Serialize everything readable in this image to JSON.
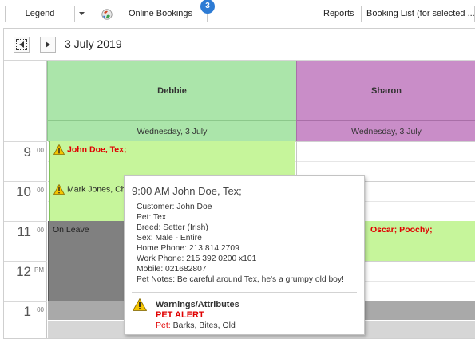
{
  "toolbar": {
    "legend_label": "Legend",
    "bookings_label": "Online Bookings",
    "bookings_badge": "3",
    "reports_label": "Reports",
    "reports_value": "Booking List (for selected ..."
  },
  "datenav": {
    "date": "3 July 2019"
  },
  "resources": [
    {
      "name": "Debbie",
      "day": "Wednesday, 3 July",
      "color": "#abe5aa"
    },
    {
      "name": "Sharon",
      "day": "Wednesday, 3 July",
      "color": "#c98dc8"
    }
  ],
  "hours": [
    {
      "h": "9",
      "m": "00"
    },
    {
      "h": "10",
      "m": "00"
    },
    {
      "h": "11",
      "m": "00"
    },
    {
      "h": "12",
      "m": "PM"
    },
    {
      "h": "1",
      "m": "00"
    }
  ],
  "appointments": {
    "tex": "John Doe, Tex;",
    "mark": "Mark Jones, Ch",
    "leave": "On Leave",
    "oscar": "Oscar; Poochy;"
  },
  "tooltip": {
    "title": "9:00 AM John Doe, Tex;",
    "customer": "Customer: John Doe",
    "pet": "Pet: Tex",
    "breed": "Breed: Setter (Irish)",
    "sex": "Sex: Male - Entire",
    "home_phone": "Home Phone: 213 814 2709",
    "work_phone": "Work Phone: 215 392 0200 x101",
    "mobile": "Mobile: 021682807",
    "notes": "Pet Notes: Be careful around Tex, he's a grumpy old boy!",
    "warnings_heading": "Warnings/Attributes",
    "alert": "PET ALERT",
    "pet_key": "Pet:",
    "pet_value": "Barks, Bites, Old"
  },
  "colors": {
    "appointment_green": "#c6f59b",
    "leave_gray": "#808080",
    "alert_red": "#e00000",
    "badge_blue": "#2d7bd4"
  },
  "icons": [
    "chevron-down-icon",
    "bookings-globe-icon",
    "arrow-left-icon",
    "arrow-right-icon",
    "warning-icon"
  ]
}
